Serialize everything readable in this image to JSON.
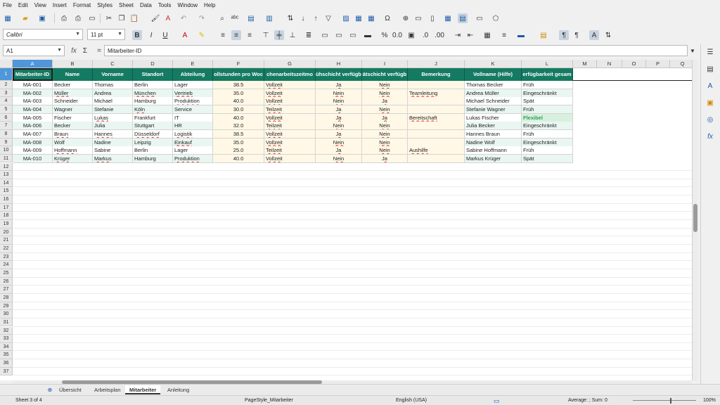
{
  "menu": [
    "File",
    "Edit",
    "View",
    "Insert",
    "Format",
    "Styles",
    "Sheet",
    "Data",
    "Tools",
    "Window",
    "Help"
  ],
  "toolbar": {
    "font_name": "Calibri",
    "font_size": "11 pt"
  },
  "formula_bar": {
    "cell_ref": "A1",
    "content": "Mitarbeiter-ID",
    "fx": "fx",
    "sigma": "Σ",
    "equals": "="
  },
  "columns": [
    "A",
    "B",
    "C",
    "D",
    "E",
    "F",
    "G",
    "H",
    "I",
    "J",
    "K",
    "L",
    "M",
    "N",
    "O",
    "P",
    "Q"
  ],
  "headers": [
    "Mitarbeiter-ID",
    "Name",
    "Vorname",
    "Standort",
    "Abteilung",
    "ollstunden pro Woc",
    "chenarbeitszeitmo",
    "ühschicht verfügb",
    "ätschicht verfügb",
    "Bemerkung",
    "Vollname (Hilfe)",
    "erfügbarkeit gesam"
  ],
  "rows": [
    [
      "MA-001",
      "Becker",
      "Thomas",
      "Berlin",
      "Lager",
      "38.5",
      "Vollzeit",
      "Ja",
      "Nein",
      "",
      "Thomas Becker",
      "Früh"
    ],
    [
      "MA-002",
      "Müller",
      "Andrea",
      "München",
      "Vertrieb",
      "35.0",
      "Vollzeit",
      "Nein",
      "Nein",
      "Teamleitung",
      "Andrea Müller",
      "Eingeschränkt"
    ],
    [
      "MA-003",
      "Schneider",
      "Michael",
      "Hamburg",
      "Produktion",
      "40.0",
      "Vollzeit",
      "Nein",
      "Ja",
      "",
      "Michael Schneider",
      "Spät"
    ],
    [
      "MA-004",
      "Wagner",
      "Stefanie",
      "Köln",
      "Service",
      "30.0",
      "Teilzeit",
      "Ja",
      "Nein",
      "",
      "Stefanie Wagner",
      "Früh"
    ],
    [
      "MA-005",
      "Fischer",
      "Lukas",
      "Frankfurt",
      "IT",
      "40.0",
      "Vollzeit",
      "Ja",
      "Ja",
      "Bereitschaft",
      "Lukas Fischer",
      "Flexibel"
    ],
    [
      "MA-006",
      "Becker",
      "Julia",
      "Stuttgart",
      "HR",
      "32.0",
      "Teilzeit",
      "Nein",
      "Nein",
      "",
      "Julia Becker",
      "Eingeschränkt"
    ],
    [
      "MA-007",
      "Braun",
      "Hannes",
      "Düsseldorf",
      "Logistik",
      "38.5",
      "Vollzeit",
      "Ja",
      "Nein",
      "",
      "Hannes Braun",
      "Früh"
    ],
    [
      "MA-008",
      "Wolf",
      "Nadine",
      "Leipzig",
      "Einkauf",
      "35.0",
      "Vollzeit",
      "Nein",
      "Nein",
      "",
      "Nadine Wolf",
      "Eingeschränkt"
    ],
    [
      "MA-009",
      "Hoffmann",
      "Sabine",
      "Berlin",
      "Lager",
      "25.0",
      "Teilzeit",
      "Ja",
      "Nein",
      "Aushilfe",
      "Sabine Hoffmann",
      "Früh"
    ],
    [
      "MA-010",
      "Krüger",
      "Markus",
      "Hamburg",
      "Produktion",
      "40.0",
      "Vollzeit",
      "Nein",
      "Ja",
      "",
      "Markus Krüger",
      "Spät"
    ]
  ],
  "row_numbers": [
    "1",
    "2",
    "3",
    "4",
    "5",
    "6",
    "7",
    "8",
    "9",
    "10",
    "11",
    "12",
    "13",
    "14",
    "15",
    "16",
    "17",
    "18",
    "19",
    "20",
    "21",
    "22",
    "23",
    "24",
    "25",
    "26",
    "27",
    "28",
    "29",
    "30",
    "31",
    "32",
    "33",
    "34",
    "35",
    "36",
    "37"
  ],
  "tabs": [
    "Übersicht",
    "Arbeitsplan",
    "Mitarbeiter",
    "Anleitung"
  ],
  "active_tab": "Mitarbeiter",
  "status": {
    "sheet": "Sheet 3 of 4",
    "page_style": "PageStyle_Mitarbeiter",
    "language": "English (USA)",
    "summary": "Average: ; Sum: 0",
    "zoom": "100%"
  },
  "colors": {
    "header_bg": "#157a62",
    "selection": "#4f97d9",
    "flexibel": "#2e9e58"
  }
}
